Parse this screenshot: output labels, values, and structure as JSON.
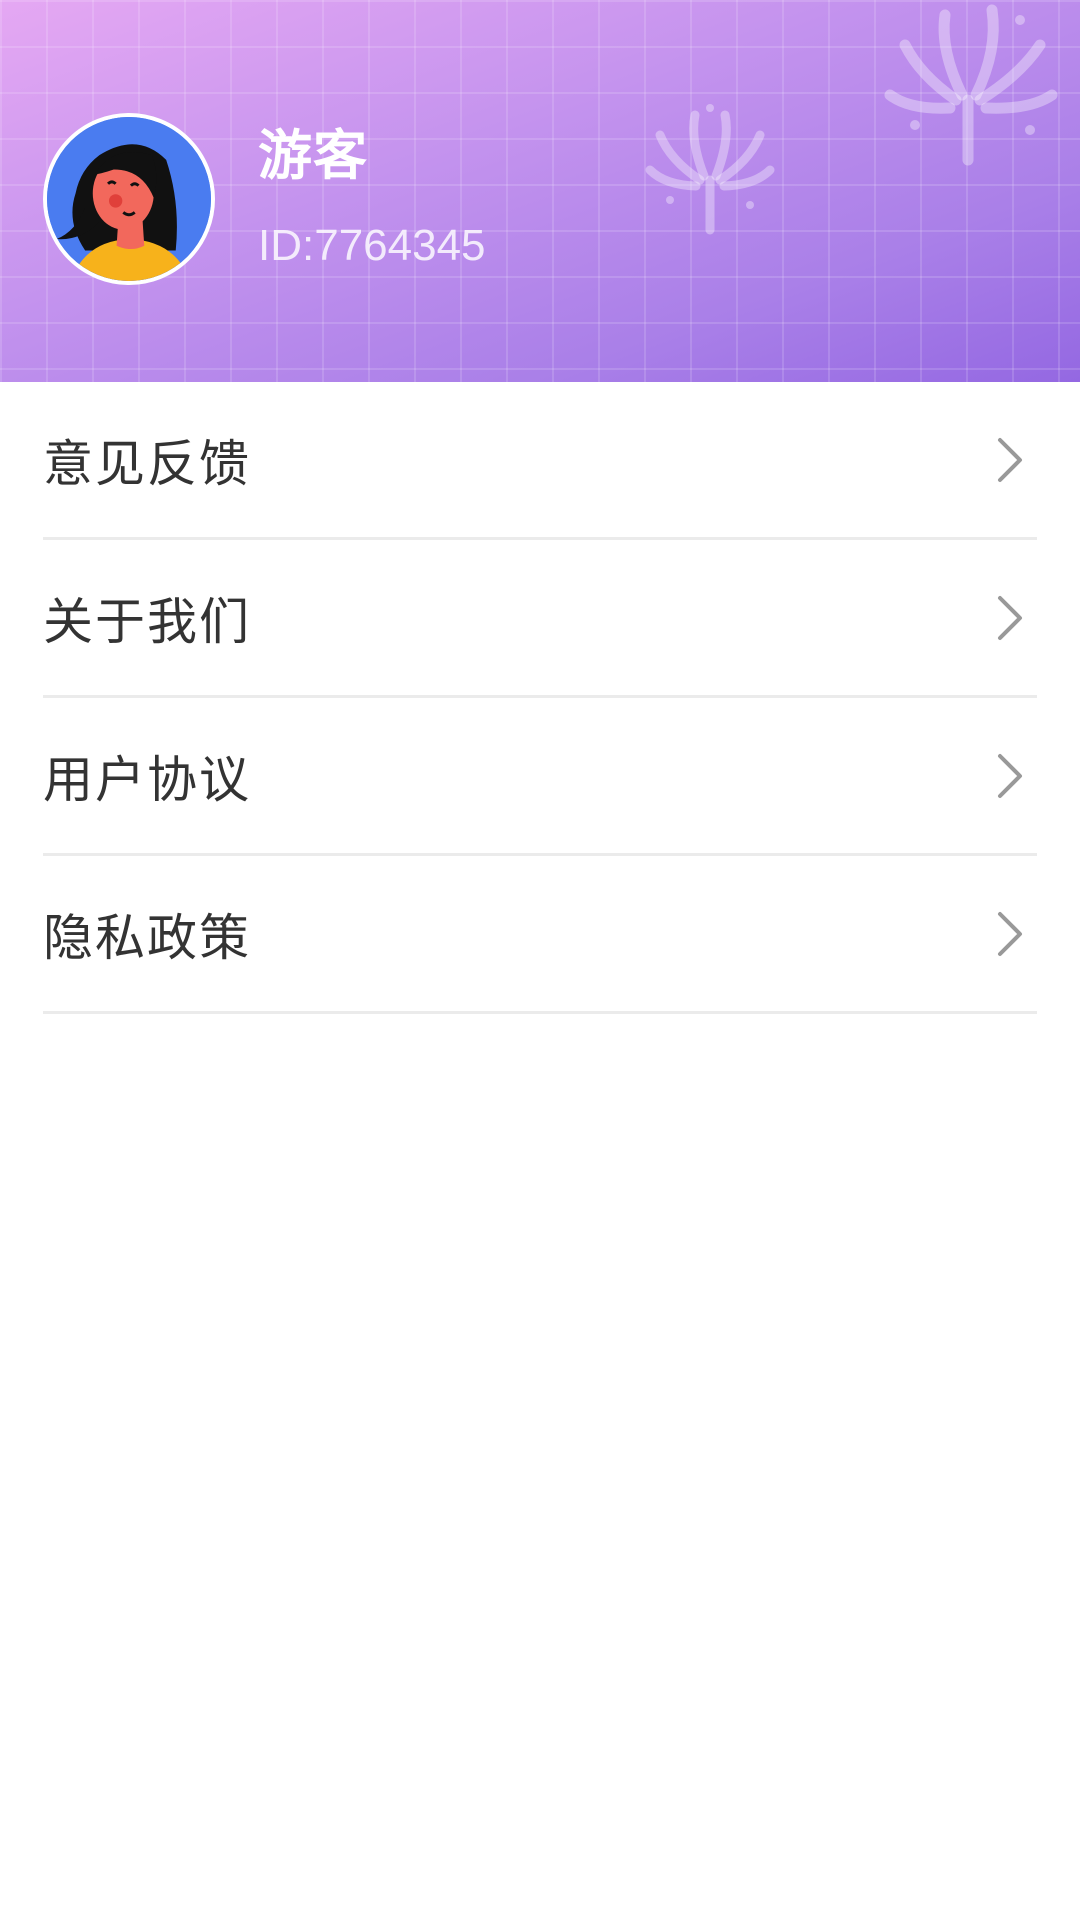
{
  "profile": {
    "name": "游客",
    "id_text": "ID:7764345"
  },
  "menu": {
    "items": [
      {
        "label": "意见反馈"
      },
      {
        "label": "关于我们"
      },
      {
        "label": "用户协议"
      },
      {
        "label": "隐私政策"
      }
    ]
  },
  "icons": {
    "avatar": "avatar-woman-icon",
    "chevron": "chevron-right-icon",
    "decoration": "firework-icon"
  },
  "colors": {
    "header_gradient_start": "#e5a8f3",
    "header_gradient_end": "#9468e2",
    "menu_text": "#333333",
    "divider": "#ebebeb",
    "chevron": "#999999"
  }
}
